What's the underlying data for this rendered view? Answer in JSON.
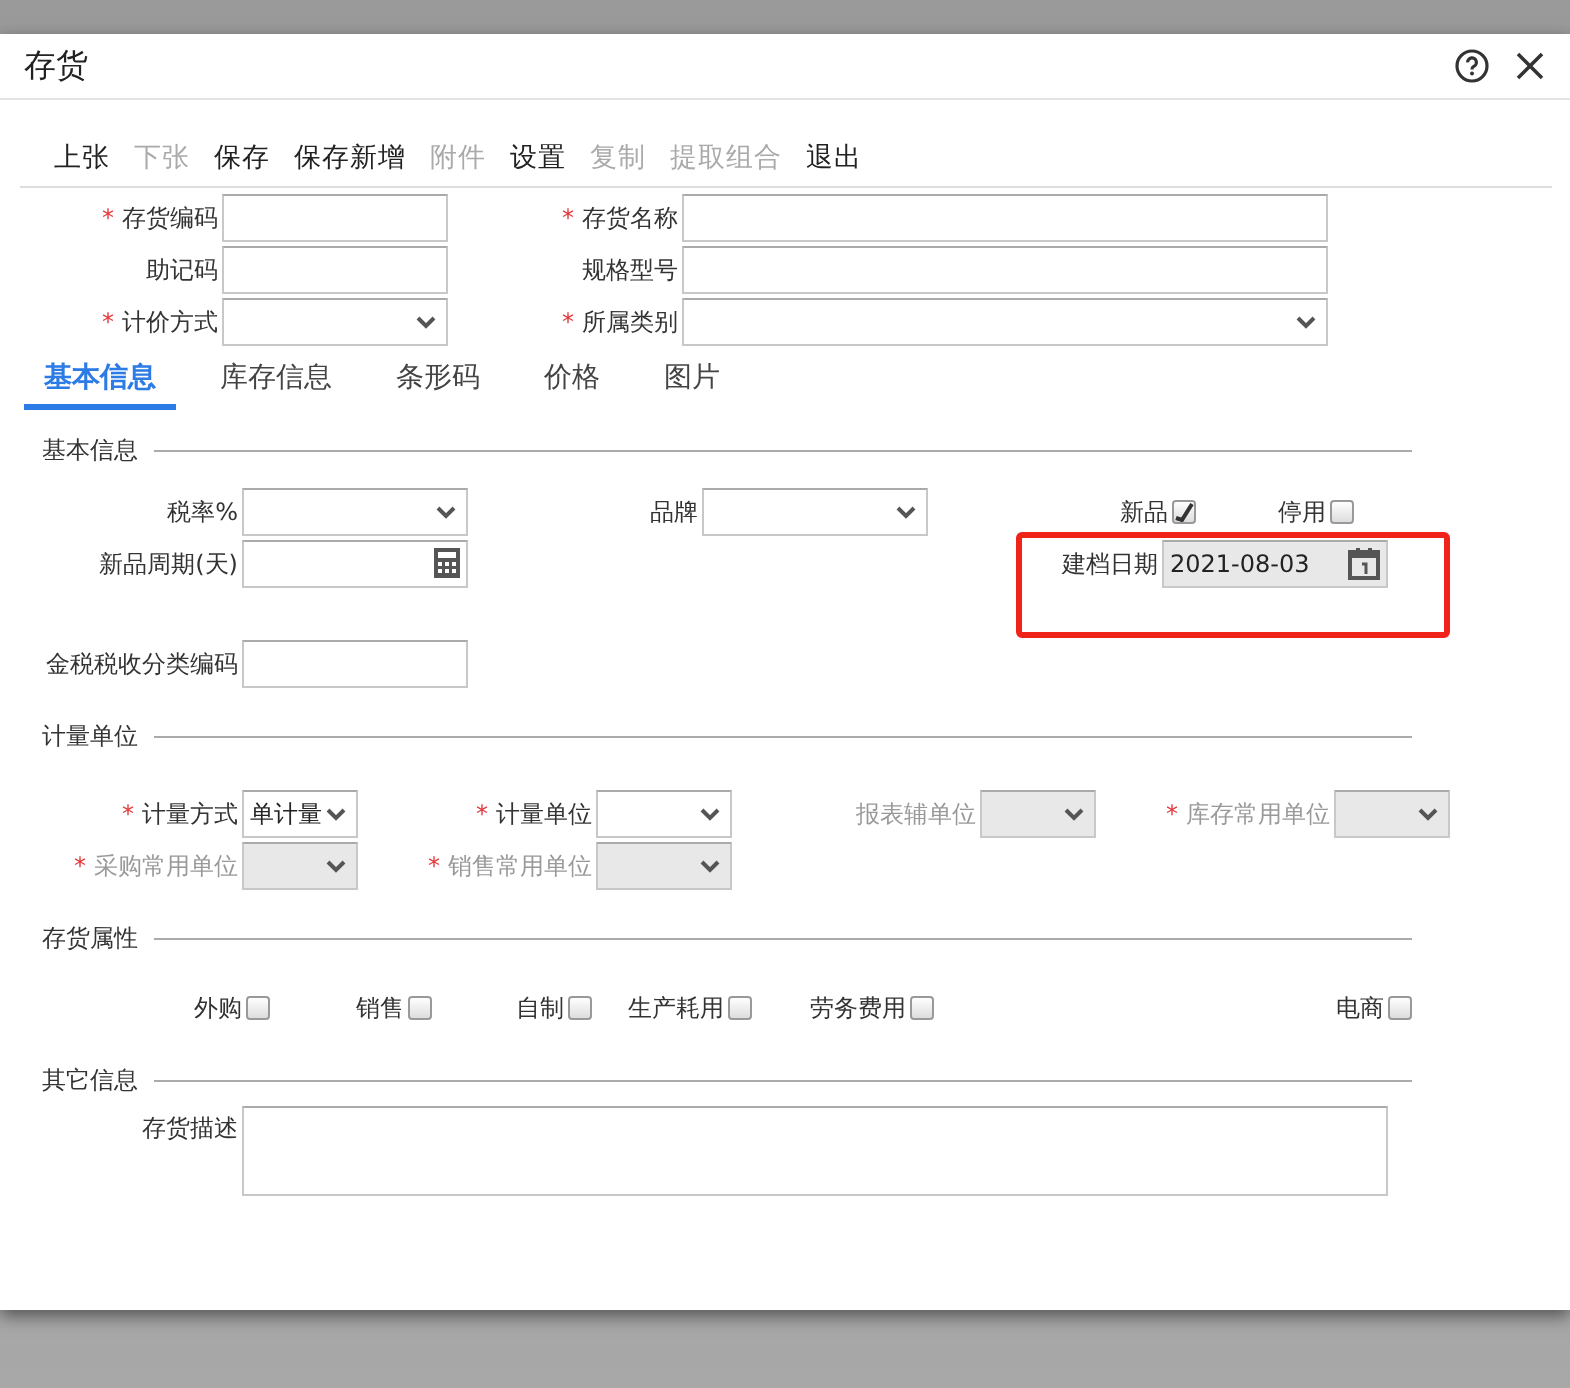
{
  "window": {
    "title": "存货"
  },
  "toolbar": [
    {
      "label": "上张",
      "disabled": false
    },
    {
      "label": "下张",
      "disabled": true
    },
    {
      "label": "保存",
      "disabled": false
    },
    {
      "label": "保存新增",
      "disabled": false
    },
    {
      "label": "附件",
      "disabled": true
    },
    {
      "label": "设置",
      "disabled": false
    },
    {
      "label": "复制",
      "disabled": true
    },
    {
      "label": "提取组合",
      "disabled": true
    },
    {
      "label": "退出",
      "disabled": false
    }
  ],
  "header_rows": [
    [
      {
        "kind": "text",
        "label": "存货编码",
        "mark": "*"
      },
      {
        "kind": "text",
        "label": "存货名称",
        "mark": "*"
      }
    ],
    [
      {
        "kind": "text",
        "label": "助记码"
      },
      {
        "kind": "text",
        "label": "规格型号"
      }
    ],
    [
      {
        "kind": "select",
        "label": "计价方式",
        "mark": "*"
      },
      {
        "kind": "select",
        "label": "所属类别",
        "mark": "*"
      }
    ]
  ],
  "tabs": [
    {
      "label": "基本信息",
      "selected": true
    },
    {
      "label": "库存信息",
      "selected": false
    },
    {
      "label": "条形码",
      "selected": false
    },
    {
      "label": "价格",
      "selected": false
    },
    {
      "label": "图片",
      "selected": false
    }
  ],
  "sections": [
    {
      "title": "基本信息",
      "rows": [
        [
          {
            "kind": "select",
            "label": "税率%"
          },
          {
            "kind": "select",
            "label": "品牌"
          }
        ],
        [
          {
            "kind": "calc",
            "label": "新品周期(天)"
          }
        ],
        [
          {
            "kind": "text",
            "label": "金税税收分类编码"
          }
        ]
      ],
      "flags": [
        {
          "kind": "checkbox",
          "label": "新品",
          "checked": true
        },
        {
          "kind": "checkbox",
          "label": "停用",
          "checked": false
        }
      ],
      "created_date": {
        "kind": "date",
        "label": "建档日期",
        "value": "2021-08-03"
      }
    },
    {
      "title": "计量单位",
      "rows": [
        [
          {
            "kind": "select",
            "label": "计量方式",
            "mark": "*",
            "disabled": false,
            "value": "单计量"
          },
          {
            "kind": "select",
            "label": "计量单位",
            "mark": "*",
            "disabled": false
          },
          {
            "kind": "select",
            "label": "报表辅单位",
            "disabled": true
          },
          {
            "kind": "select",
            "label": "库存常用单位",
            "mark": "*",
            "disabled": true
          }
        ],
        [
          {
            "kind": "select",
            "label": "采购常用单位",
            "mark": "*",
            "disabled": true
          },
          {
            "kind": "select",
            "label": "销售常用单位",
            "mark": "*",
            "disabled": true
          }
        ]
      ]
    },
    {
      "title": "存货属性",
      "rows": [
        [
          {
            "kind": "checkbox",
            "label": "外购",
            "checked": false
          },
          {
            "kind": "checkbox",
            "label": "销售",
            "checked": false
          },
          {
            "kind": "checkbox",
            "label": "自制",
            "checked": false
          },
          {
            "kind": "checkbox",
            "label": "生产耗用",
            "checked": false
          },
          {
            "kind": "checkbox",
            "label": "劳务费用",
            "checked": false
          },
          {
            "kind": "checkbox",
            "label": "电商",
            "checked": false
          }
        ]
      ]
    },
    {
      "title": "其它信息",
      "rows": [
        [
          {
            "kind": "textarea",
            "label": "存货描述"
          }
        ]
      ]
    }
  ]
}
